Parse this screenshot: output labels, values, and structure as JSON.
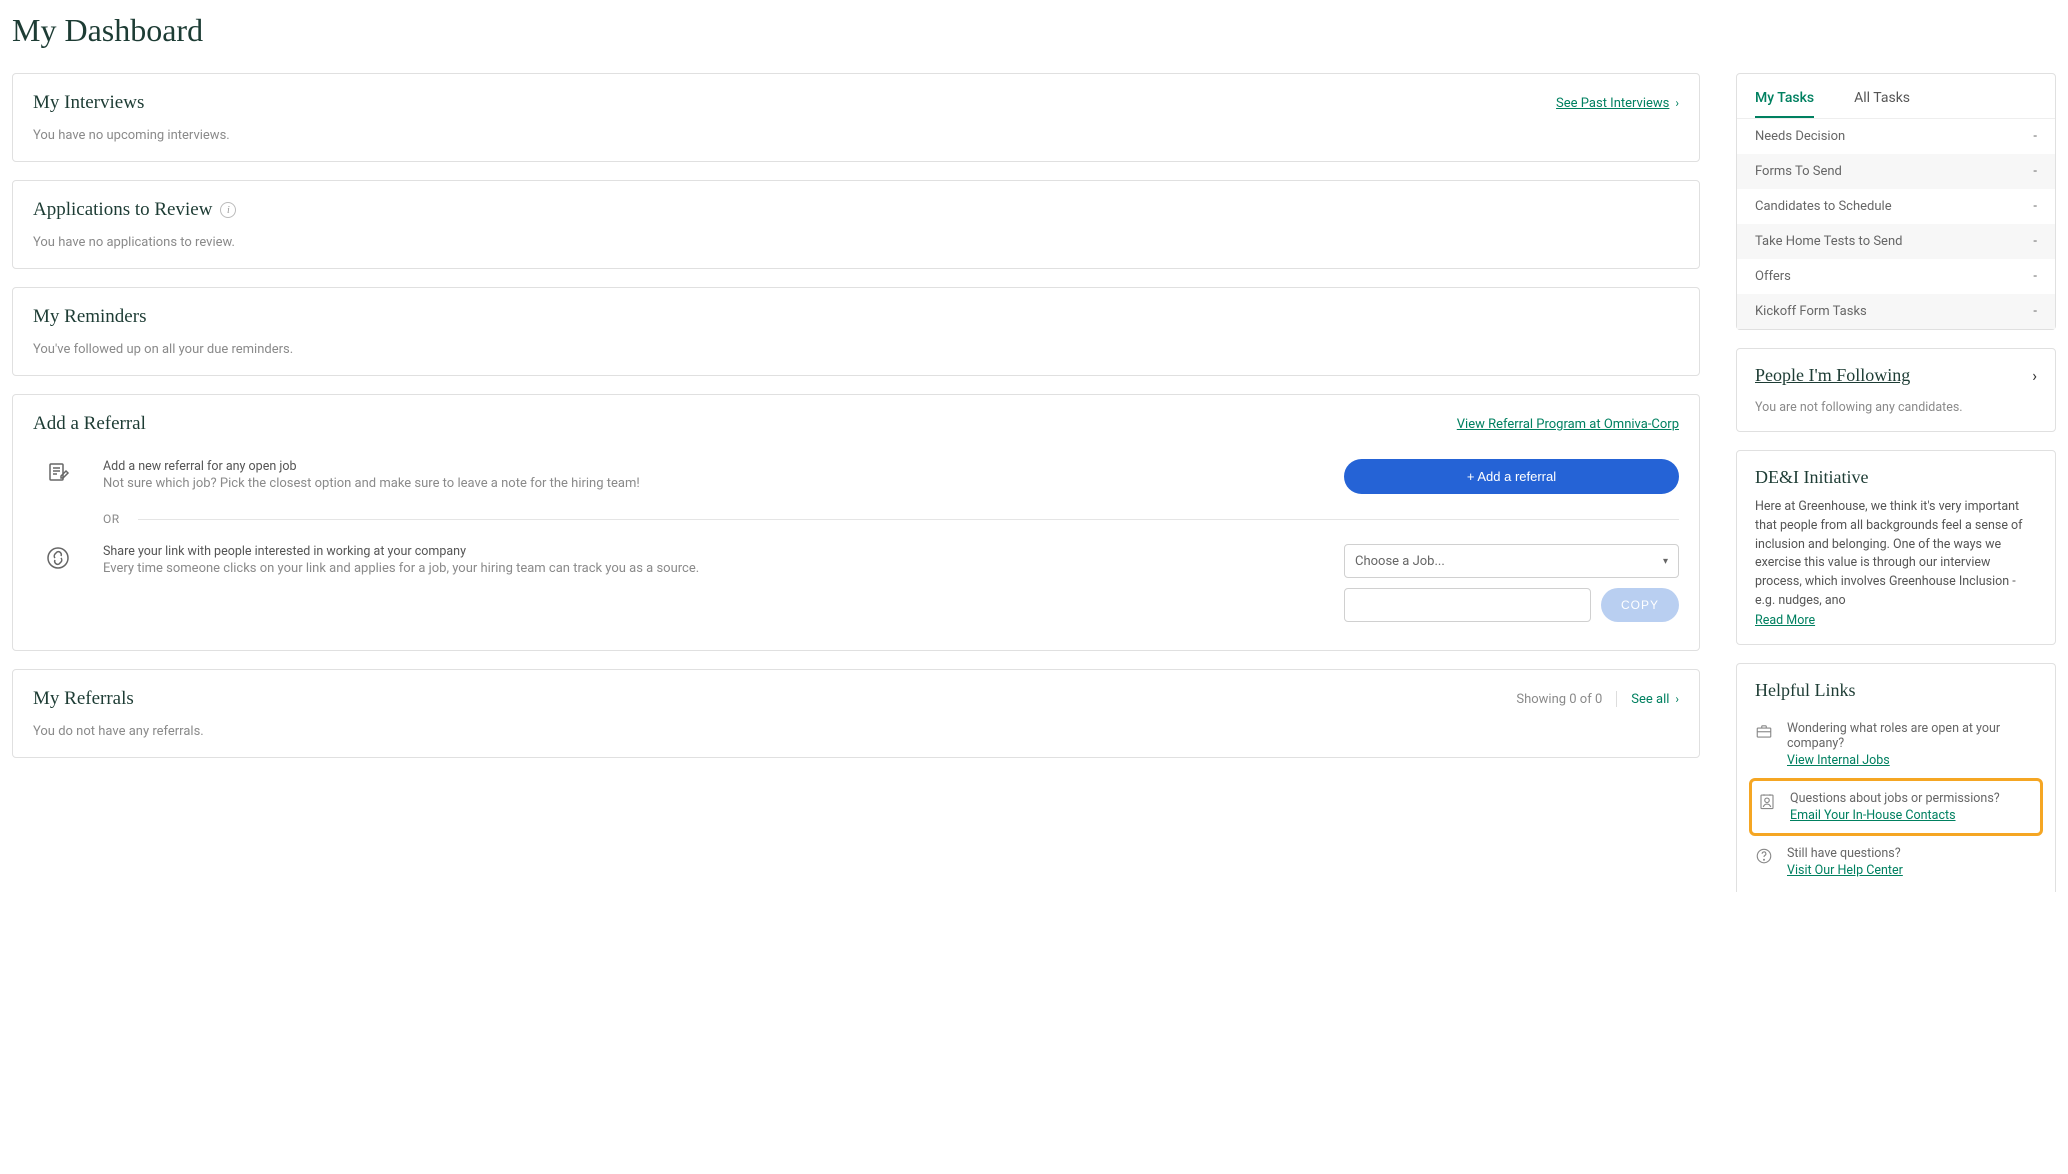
{
  "page_title": "My Dashboard",
  "interviews": {
    "title": "My Interviews",
    "link": "See Past Interviews",
    "empty": "You have no upcoming interviews."
  },
  "applications": {
    "title": "Applications to Review",
    "empty": "You have no applications to review."
  },
  "reminders": {
    "title": "My Reminders",
    "empty": "You've followed up on all your due reminders."
  },
  "referral": {
    "title": "Add a Referral",
    "program_link": "View Referral Program at Omniva-Corp",
    "add_head": "Add a new referral for any open job",
    "add_body": "Not sure which job? Pick the closest option and make sure to leave a note for the hiring team!",
    "add_button": "+ Add a referral",
    "or": "OR",
    "share_head": "Share your link with people interested in working at your company",
    "share_body": "Every time someone clicks on your link and applies for a job, your hiring team can track you as a source.",
    "job_placeholder": "Choose a Job...",
    "copy": "COPY"
  },
  "my_referrals": {
    "title": "My Referrals",
    "showing": "Showing 0 of 0",
    "see_all": "See all",
    "empty": "You do not have any referrals."
  },
  "tasks": {
    "tab_my": "My Tasks",
    "tab_all": "All Tasks",
    "rows": [
      {
        "label": "Needs Decision",
        "val": "-"
      },
      {
        "label": "Forms To Send",
        "val": "-"
      },
      {
        "label": "Candidates to Schedule",
        "val": "-"
      },
      {
        "label": "Take Home Tests to Send",
        "val": "-"
      },
      {
        "label": "Offers",
        "val": "-"
      },
      {
        "label": "Kickoff Form Tasks",
        "val": "-"
      }
    ]
  },
  "following": {
    "title": "People I'm Following",
    "empty": "You are not following any candidates."
  },
  "dei": {
    "title": "DE&I Initiative",
    "body": "Here at Greenhouse, we think it's very important that people from all backgrounds feel a sense of inclusion and belonging. One of the ways we exercise this value is through our interview process, which involves Greenhouse Inclusion - e.g. nudges, ano",
    "read_more": "Read More"
  },
  "helpful": {
    "title": "Helpful Links",
    "roles_q": "Wondering what roles are open at your company?",
    "roles_link": "View Internal Jobs",
    "perm_q": "Questions about jobs or permissions?",
    "perm_link": "Email Your In-House Contacts",
    "still_q": "Still have questions?",
    "still_link": "Visit Our Help Center"
  }
}
